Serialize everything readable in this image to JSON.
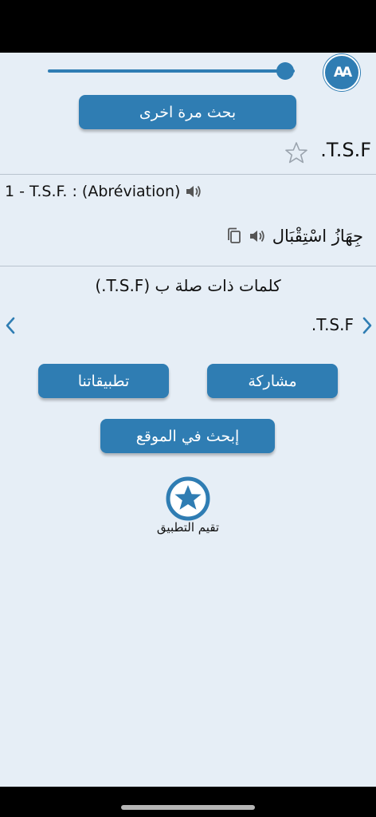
{
  "font_size_control": {
    "icon": "font-size-icon",
    "label": "AA",
    "slider_level": 0.96
  },
  "buttons": {
    "search_again": "بحث مرة اخرى",
    "share": "مشاركة",
    "our_apps": "تطبيقاتنا",
    "search_site": "إبحث في الموقع"
  },
  "word": {
    "title": "T.S.F.",
    "favorite_icon": "star-outline-icon"
  },
  "entry": {
    "definition": "1 - T.S.F. : (Abréviation)",
    "translation": "جِهَازُ اسْتِقْبَال",
    "speaker_icon": "speaker-icon",
    "copy_icon": "copy-icon"
  },
  "related": {
    "heading": "كلمات ذات صلة ب (T.S.F.)",
    "item": "T.S.F."
  },
  "rate": {
    "icon": "star-circle-icon",
    "label": "تقيم التطبيق"
  },
  "colors": {
    "accent": "#2f7db3",
    "background": "#e6eef6"
  }
}
